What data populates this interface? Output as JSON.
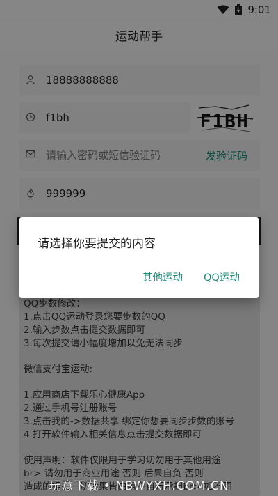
{
  "status_bar": {
    "time": "9:01",
    "wifi_icon": "wifi-icon",
    "battery_icon": "battery-charging-icon"
  },
  "app_bar": {
    "title": "运动帮手"
  },
  "form": {
    "phone": {
      "value": "18888888888",
      "icon": "user-icon"
    },
    "captcha": {
      "value": "f1bh",
      "icon": "clock-icon",
      "image_text": "F1BH"
    },
    "password": {
      "placeholder": "请输入密码或短信验证码",
      "icon": "mail-icon",
      "sms_link": "发验证码"
    },
    "steps": {
      "value": "999999",
      "icon": "fire-icon"
    }
  },
  "instructions": {
    "lines": [
      "QQ步数修改：",
      "1.点击QQ运动登录您要步数的QQ",
      "2.输入步数点击提交数据即可",
      "3.每次提交请小幅度增加以免无法同步",
      "",
      "微信支付宝运动:",
      "",
      "1.应用商店下载乐心健康App",
      "2.通过手机号注册账号",
      "3.点击我的->数据共享 绑定你想要同步步数的账号",
      "4.打开软件输入相关信息点击提交数据即可",
      "",
      "使用声明：软件仅限用于学习切勿用于其他用途",
      "br> 请勿用于商业用途 否则 后果自负 否则",
      "造成的相关一切后果皆由用户自行承担br> 如不同"
    ]
  },
  "dialog": {
    "title": "请选择你要提交的内容",
    "button_other": "其他运动",
    "button_qq": "QQ运动"
  },
  "watermark": "玩意下载 • NBWYXH.COM.CN",
  "colors": {
    "accent": "#1b8c7a",
    "background": "#f2f2f2",
    "scrim": "rgba(0,0,0,0.45)"
  }
}
